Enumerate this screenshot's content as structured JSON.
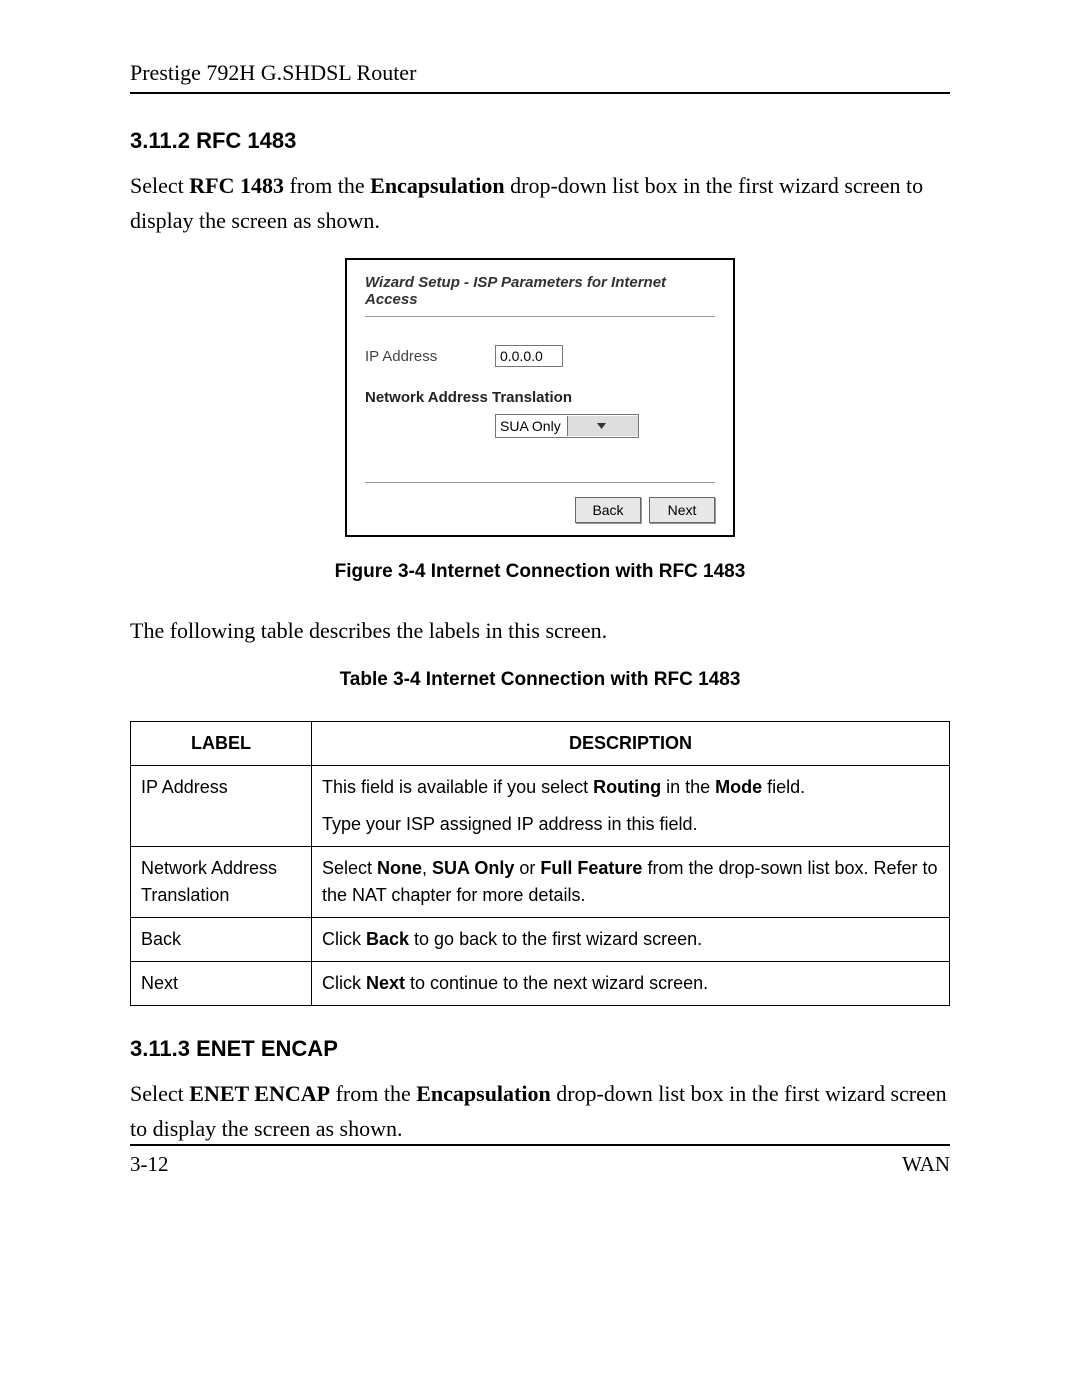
{
  "header": {
    "title": "Prestige 792H G.SHDSL Router"
  },
  "section1": {
    "heading": "3.11.2 RFC 1483",
    "para_prefix": "Select ",
    "bold1": "RFC 1483",
    "para_mid1": " from the ",
    "bold2": "Encapsulation",
    "para_suffix": " drop-down list box in the first wizard screen to display the screen as shown."
  },
  "wizard": {
    "title": "Wizard Setup - ISP Parameters for Internet Access",
    "ip_label": "IP Address",
    "ip_value": "0.0.0.0",
    "nat_heading": "Network Address Translation",
    "nat_value": "SUA Only",
    "back": "Back",
    "next": "Next"
  },
  "figure_caption": "Figure 3-4 Internet Connection with RFC 1483",
  "table_intro": "The following table describes the labels in this screen.",
  "table_caption": "Table 3-4 Internet Connection with RFC 1483",
  "table": {
    "headers": {
      "label": "LABEL",
      "desc": "DESCRIPTION"
    },
    "rows": [
      {
        "label": "IP Address",
        "desc_pre": "This field is available if you select ",
        "desc_b1": "Routing",
        "desc_mid": " in the ",
        "desc_b2": "Mode",
        "desc_post": " field.",
        "desc_line2": "Type your ISP assigned IP address in this field."
      },
      {
        "label": "Network Address Translation",
        "desc_pre": "Select ",
        "desc_b1": "None",
        "desc_sep1": ", ",
        "desc_b2": "SUA Only",
        "desc_sep2": " or ",
        "desc_b3": "Full Feature",
        "desc_post": " from the drop-sown list box. Refer to the NAT chapter for more details."
      },
      {
        "label": "Back",
        "desc_pre": "Click ",
        "desc_b1": "Back",
        "desc_post": " to go back to the first wizard screen."
      },
      {
        "label": "Next",
        "desc_pre": "Click ",
        "desc_b1": "Next",
        "desc_post": " to continue to the next wizard screen."
      }
    ]
  },
  "section2": {
    "heading": "3.11.3 ENET ENCAP",
    "para_prefix": "Select ",
    "bold1": "ENET ENCAP",
    "para_mid1": " from the ",
    "bold2": "Encapsulation",
    "para_suffix": " drop-down list box in the first wizard screen to display the screen as shown."
  },
  "footer": {
    "left": "3-12",
    "right": "WAN"
  }
}
